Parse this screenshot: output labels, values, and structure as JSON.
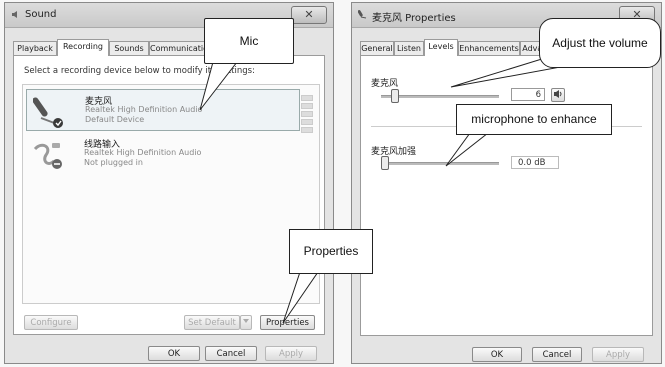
{
  "sound": {
    "title": "Sound",
    "close": "✕",
    "tabs": [
      "Playback",
      "Recording",
      "Sounds",
      "Communications"
    ],
    "instruction": "Select a recording device below to modify its settings:",
    "devices": [
      {
        "name": "麦克风",
        "driver": "Realtek High Definition Audio",
        "status": "Default Device"
      },
      {
        "name": "线路输入",
        "driver": "Realtek High Definition Audio",
        "status": "Not plugged in"
      }
    ],
    "configure": "Configure",
    "set_default": "Set Default",
    "properties": "Properties",
    "ok": "OK",
    "cancel": "Cancel",
    "apply": "Apply"
  },
  "props": {
    "title": "麦克风 Properties",
    "close": "✕",
    "tabs": [
      "General",
      "Listen",
      "Levels",
      "Enhancements",
      "Advanced"
    ],
    "mic_label": "麦克风",
    "mic_value": "6",
    "boost_label": "麦克风加强",
    "boost_value": "0.0 dB",
    "ok": "OK",
    "cancel": "Cancel",
    "apply": "Apply"
  },
  "callouts": {
    "mic": "Mic",
    "properties": "Properties",
    "volume": "Adjust the volume",
    "enhance": "microphone to enhance"
  }
}
